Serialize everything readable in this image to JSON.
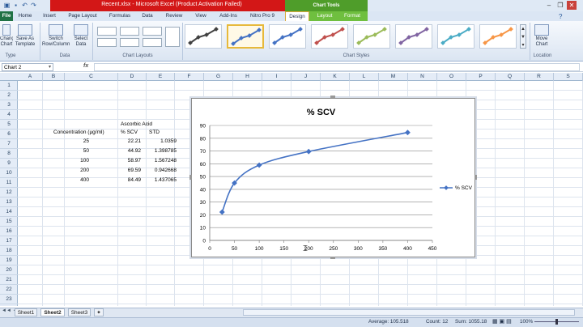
{
  "titlebar": {
    "title": "Recent.xlsx - Microsoft Excel (Product Activation Failed)",
    "contextual": "Chart Tools"
  },
  "tabs": [
    "File",
    "Home",
    "Insert",
    "Page Layout",
    "Formulas",
    "Data",
    "Review",
    "View",
    "Add-Ins",
    "Nitro Pro 9",
    "Design",
    "Layout",
    "Format"
  ],
  "ribbon": {
    "type_btns": [
      "Change Chart Type",
      "Save As Template"
    ],
    "data_btns": [
      "Switch Row/Column",
      "Select Data"
    ],
    "groups": [
      "Type",
      "Data",
      "Chart Layouts",
      "Chart Styles",
      "Location"
    ],
    "move_chart": "Move Chart"
  },
  "formula": {
    "namebox": "Chart 2",
    "fx": "fx"
  },
  "columns": [
    "A",
    "B",
    "C",
    "D",
    "E",
    "F",
    "G",
    "H",
    "I",
    "J",
    "K",
    "L",
    "M",
    "N",
    "O",
    "P",
    "Q",
    "R",
    "S"
  ],
  "rows": [
    "1",
    "2",
    "3",
    "4",
    "5",
    "6",
    "7",
    "8",
    "9",
    "10",
    "11",
    "12",
    "13",
    "14",
    "15",
    "16",
    "17",
    "18",
    "19",
    "20",
    "21",
    "22",
    "23"
  ],
  "table": {
    "header_title": "Ascorbic Acid",
    "col_conc": "Concentration (µg/ml)",
    "col_scv": "% SCV",
    "col_std": "STD",
    "rows": [
      [
        "25",
        "22.21",
        "1.0359"
      ],
      [
        "50",
        "44.92",
        "1.398785"
      ],
      [
        "100",
        "58.97",
        "1.567248"
      ],
      [
        "200",
        "69.59",
        "0.942668"
      ],
      [
        "400",
        "84.49",
        "1.437065"
      ]
    ]
  },
  "chart_data": {
    "type": "scatter",
    "title": "% SCV",
    "x": [
      25,
      50,
      100,
      200,
      400
    ],
    "series": [
      {
        "name": "% SCV",
        "values": [
          22.21,
          44.92,
          58.97,
          69.59,
          84.49
        ]
      }
    ],
    "xlim": [
      0,
      450
    ],
    "ylim": [
      0,
      90
    ],
    "xticks": [
      "0",
      "50",
      "100",
      "150",
      "200",
      "250",
      "300",
      "350",
      "400",
      "450"
    ],
    "yticks": [
      "0",
      "10",
      "20",
      "30",
      "40",
      "50",
      "60",
      "70",
      "80",
      "90"
    ],
    "grid": "horizontal",
    "legend": "right",
    "smooth": true,
    "color": "#4472c4"
  },
  "sheets": [
    "Sheet1",
    "Sheet2",
    "Sheet3"
  ],
  "status": {
    "average": "Average: 105.518",
    "count": "Count: 12",
    "sum": "Sum: 1055.18",
    "zoom": "100%"
  }
}
